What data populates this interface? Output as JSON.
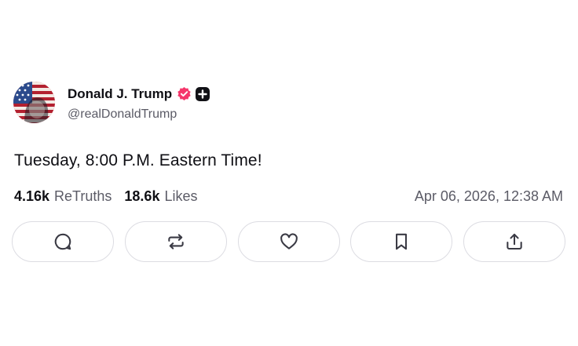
{
  "author": {
    "display_name": "Donald J. Trump",
    "handle": "@realDonaldTrump",
    "avatar_icon": "flag-portrait-avatar",
    "verified_color": "#f5366b"
  },
  "post": {
    "text": "Tuesday, 8:00 P.M. Eastern Time!"
  },
  "stats": {
    "retruths_count": "4.16k",
    "retruths_label": "ReTruths",
    "likes_count": "18.6k",
    "likes_label": "Likes",
    "timestamp": "Apr 06, 2026, 12:38 AM"
  },
  "actions": [
    {
      "name": "reply",
      "icon": "comment-icon"
    },
    {
      "name": "retruth",
      "icon": "repost-icon"
    },
    {
      "name": "like",
      "icon": "heart-icon"
    },
    {
      "name": "bookmark",
      "icon": "bookmark-icon"
    },
    {
      "name": "share",
      "icon": "share-icon"
    }
  ]
}
